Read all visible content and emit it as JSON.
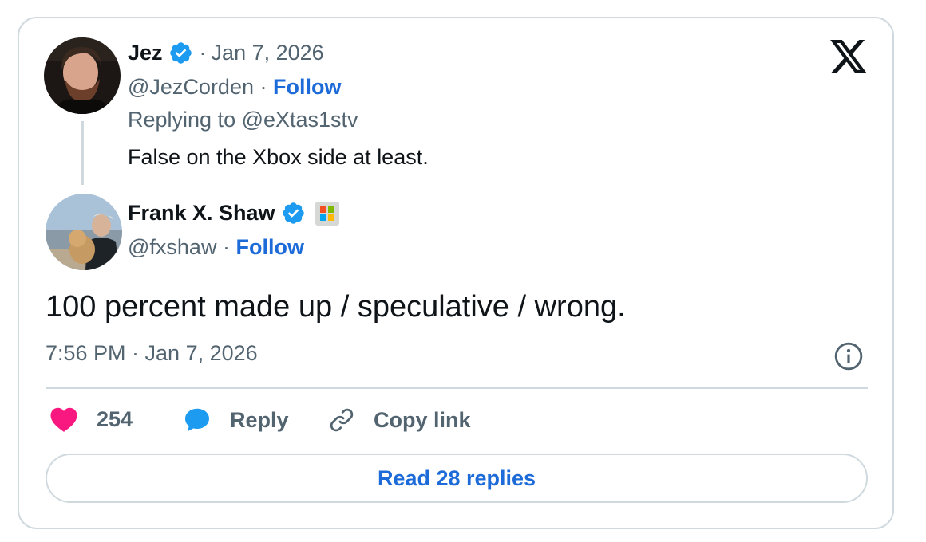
{
  "quoted": {
    "name": "Jez",
    "handle": "@JezCorden",
    "date": "Jan 7, 2026",
    "follow_label": "Follow",
    "replying_to": "Replying to @eXtas1stv",
    "text": "False on the Xbox side at least."
  },
  "tweet": {
    "name": "Frank X. Shaw",
    "handle": "@fxshaw",
    "follow_label": "Follow",
    "text": "100 percent made up / speculative / wrong.",
    "timestamp": "7:56 PM · Jan 7, 2026"
  },
  "actions": {
    "likes": "254",
    "reply_label": "Reply",
    "copy_link_label": "Copy link",
    "read_replies_label": "Read 28 replies"
  },
  "separator": "·",
  "colors": {
    "link_blue": "#1d6bd8",
    "verified_blue": "#1d9bf0",
    "heart_pink": "#f91880",
    "muted_text": "#536471",
    "border": "#cfd9de"
  },
  "icons": [
    "x-logo-icon",
    "verified-badge-icon",
    "heart-icon",
    "reply-bubble-icon",
    "link-icon",
    "info-icon"
  ]
}
